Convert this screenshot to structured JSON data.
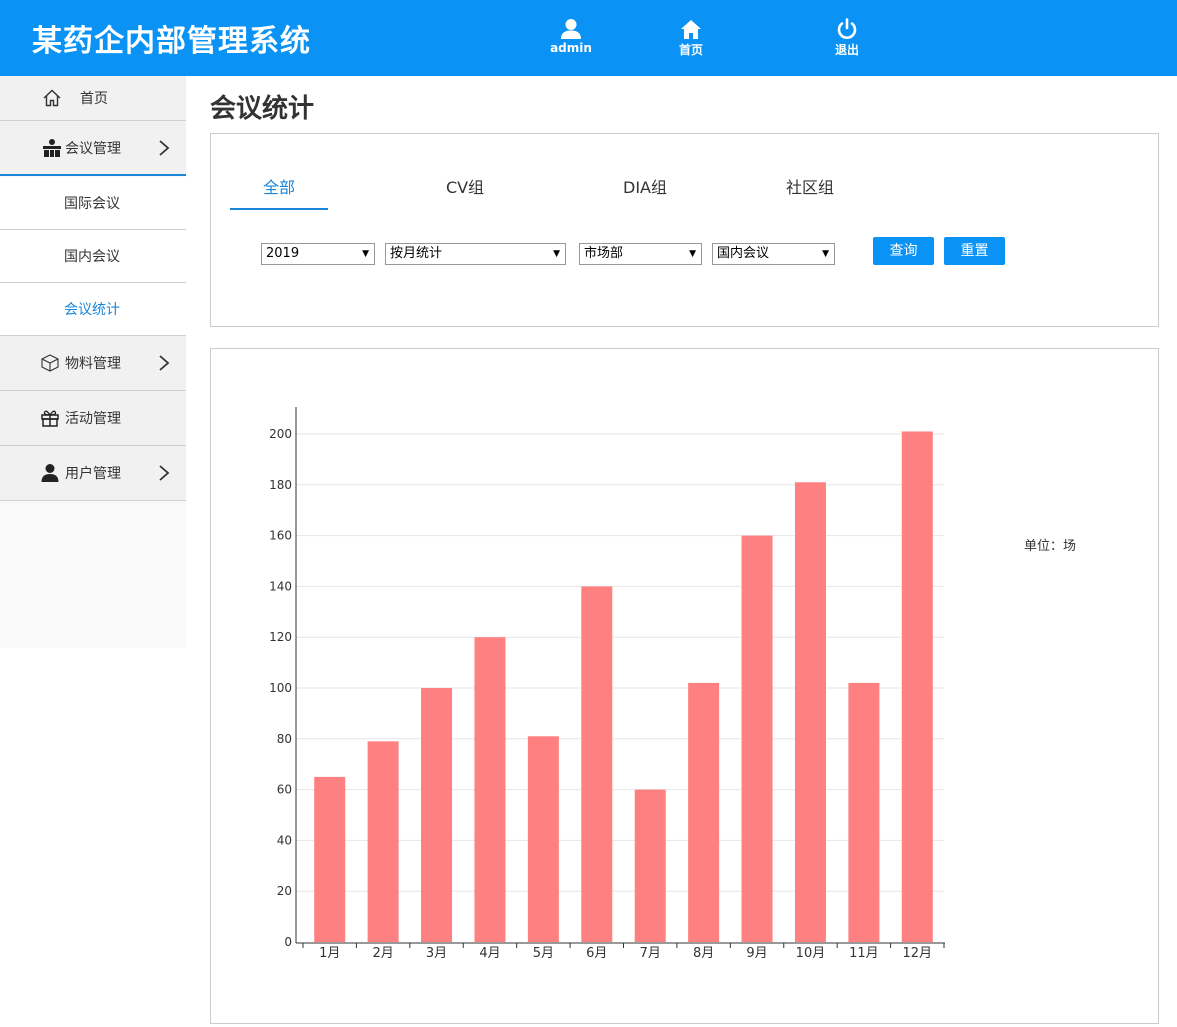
{
  "app": {
    "title": "某药企内部管理系统"
  },
  "header": {
    "user_label": "admin",
    "home_label": "首页",
    "logout_label": "退出",
    "accent": "#0a93f5"
  },
  "sidebar": {
    "home": {
      "label": "首页",
      "icon": "home-icon"
    },
    "meeting_mgmt": {
      "label": "会议管理",
      "icon": "meeting-icon"
    },
    "meeting_sub": [
      {
        "label": "国际会议"
      },
      {
        "label": "国内会议"
      },
      {
        "label": "会议统计",
        "active": true
      }
    ],
    "material_mgmt": {
      "label": "物料管理",
      "icon": "box-icon"
    },
    "activity_mgmt": {
      "label": "活动管理",
      "icon": "gift-icon"
    },
    "user_mgmt": {
      "label": "用户管理",
      "icon": "user-icon"
    }
  },
  "main": {
    "title": "会议统计",
    "tabs": [
      {
        "label": "全部",
        "active": true
      },
      {
        "label": "CV组"
      },
      {
        "label": "DIA组"
      },
      {
        "label": "社区组"
      }
    ],
    "filters": {
      "year": "2019",
      "period": "按月统计",
      "department": "市场部",
      "meeting_type": "国内会议"
    },
    "query_label": "查询",
    "reset_label": "重置",
    "unit_label": "单位：场"
  },
  "chart_data": {
    "type": "bar",
    "categories": [
      "1月",
      "2月",
      "3月",
      "4月",
      "5月",
      "6月",
      "7月",
      "8月",
      "9月",
      "10月",
      "11月",
      "12月"
    ],
    "values": [
      65,
      79,
      100,
      120,
      81,
      140,
      60,
      102,
      160,
      181,
      102,
      201
    ],
    "ylim": [
      0,
      200
    ],
    "yticks": [
      0,
      20,
      40,
      60,
      80,
      100,
      120,
      140,
      160,
      180,
      200
    ],
    "grid": true,
    "bar_color": "#ff8080"
  }
}
